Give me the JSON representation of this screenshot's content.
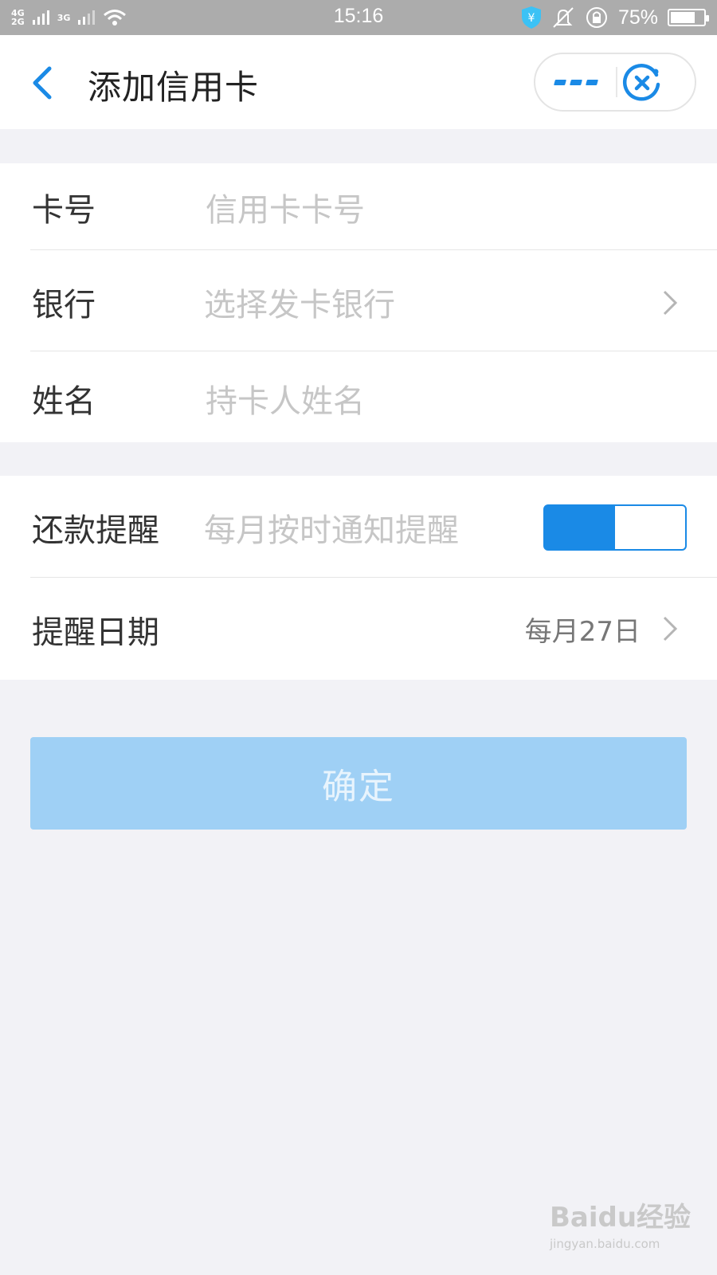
{
  "status_bar": {
    "network_1": "4G\n2G",
    "network_2": "3G",
    "time": "15:16",
    "battery_percent": "75%",
    "battery_level": 0.75
  },
  "header": {
    "title": "添加信用卡",
    "back_icon": "chevron-left-icon",
    "more_icon": "more-dots-icon",
    "close_icon": "close-circle-icon"
  },
  "form": {
    "card_number": {
      "label": "卡号",
      "placeholder": "信用卡卡号"
    },
    "bank": {
      "label": "银行",
      "placeholder": "选择发卡银行"
    },
    "name": {
      "label": "姓名",
      "placeholder": "持卡人姓名"
    }
  },
  "reminder": {
    "label": "还款提醒",
    "hint": "每月按时通知提醒",
    "enabled": true,
    "date_label": "提醒日期",
    "date_value": "每月27日"
  },
  "confirm_label": "确定",
  "watermark": {
    "logo": "Baidu经验",
    "url": "jingyan.baidu.com"
  },
  "colors": {
    "accent": "#1a8ae6",
    "confirm_disabled": "#9fd0f5",
    "background": "#f2f2f6",
    "status_bar": "#acacac"
  }
}
